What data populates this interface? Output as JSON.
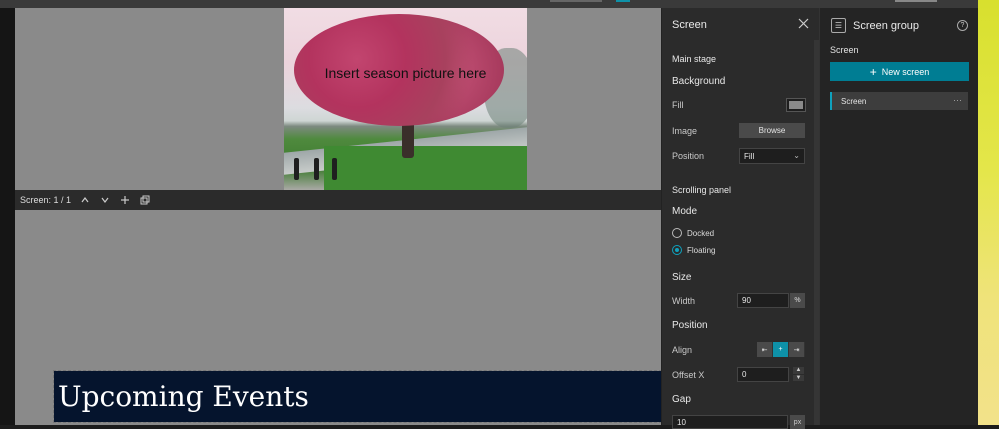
{
  "canvas": {
    "picture_caption": "Insert season picture here",
    "screen_indicator": "Screen: 1 / 1",
    "events_title": "Upcoming Events"
  },
  "screen_panel": {
    "title": "Screen",
    "main_stage": "Main stage",
    "background": "Background",
    "fill_label": "Fill",
    "fill_color": "#8a8a8a",
    "image_label": "Image",
    "browse_label": "Browse",
    "position_label": "Position",
    "position_value": "Fill",
    "scrolling_panel": "Scrolling panel",
    "mode_label": "Mode",
    "mode_docked": "Docked",
    "mode_floating": "Floating",
    "size_label": "Size",
    "width_label": "Width",
    "width_value": "90",
    "width_unit": "%",
    "position2_label": "Position",
    "align_label": "Align",
    "offset_label": "Offset X",
    "offset_value": "0",
    "gap_label": "Gap",
    "gap_value": "10",
    "gap_unit": "px"
  },
  "screen_group": {
    "title": "Screen group",
    "section": "Screen",
    "new_screen": "New screen",
    "item": "Screen",
    "more": "···"
  },
  "colors": {
    "accent": "#007d93",
    "canvas_bg": "#8a8a8a",
    "events_bg": "#05142d"
  }
}
